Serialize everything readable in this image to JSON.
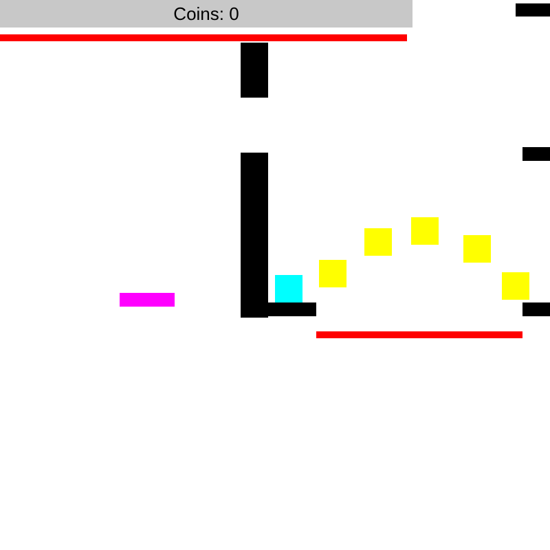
{
  "hud": {
    "coins_label": "Coins:",
    "coins_value": "0"
  },
  "colors": {
    "background": "#ffffff",
    "hud_bar": "#c8c8c8",
    "wall": "#000000",
    "hazard": "#ff0000",
    "coin": "#ffff00",
    "player": "#00ffff",
    "moving_platform": "#ff00ff"
  }
}
